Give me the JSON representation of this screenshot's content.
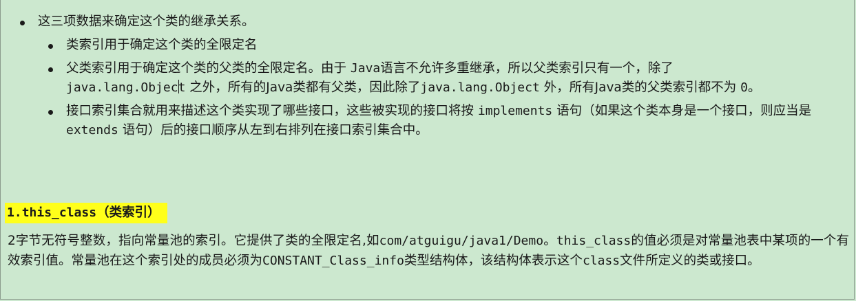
{
  "bullets": {
    "top": "这三项数据来确定这个类的继承关系。",
    "sub": [
      {
        "text": "类索引用于确定这个类的全限定名"
      },
      {
        "t1": "父类索引用于确定这个类的父类的全限定名。由于 ",
        "java": "Java",
        "t2": "语言不允许多重继承，所以父类索引只有一个，除了",
        "obj1a": "java.lang.Objec",
        "obj1b": "t",
        "t3": " 之外，所有的",
        "java2": "Java",
        "t4": "类都有父类，因此除了",
        "obj2": "java.lang.Object",
        "t5": " 外，所有",
        "java3": "Java",
        "t6": "类的父类索引都不为 ",
        "zero": "0",
        "t7": "。"
      },
      {
        "t1": "接口索引集合就用来描述这个类实现了哪些接口，这些被实现的接口将按 ",
        "impl": "implements",
        "t2": " 语句（如果这个类本身是一个接口，则应当是 ",
        "ext": "extends",
        "t3": " 语句）后的接口顺序从左到右排列在接口索引集合中。"
      }
    ]
  },
  "section": {
    "num": "1.",
    "name": "this_class",
    "suffix": "（类索引）"
  },
  "desc": {
    "a": "2字节无符号整数，指向常量池的索引。它提供了类的全限定名,如",
    "path": "com/atguigu/java1/Demo",
    "b": "。",
    "tc": "this_class",
    "c": "的值必须是对常量池表中某项的一个有效索引值。常量池在这个索引处的成员必须为",
    "ci": "CONSTANT_Class_info",
    "d": "类型结构体，该结构体表示这个",
    "cls": "class",
    "e": "文件所定义的类或接口。"
  }
}
